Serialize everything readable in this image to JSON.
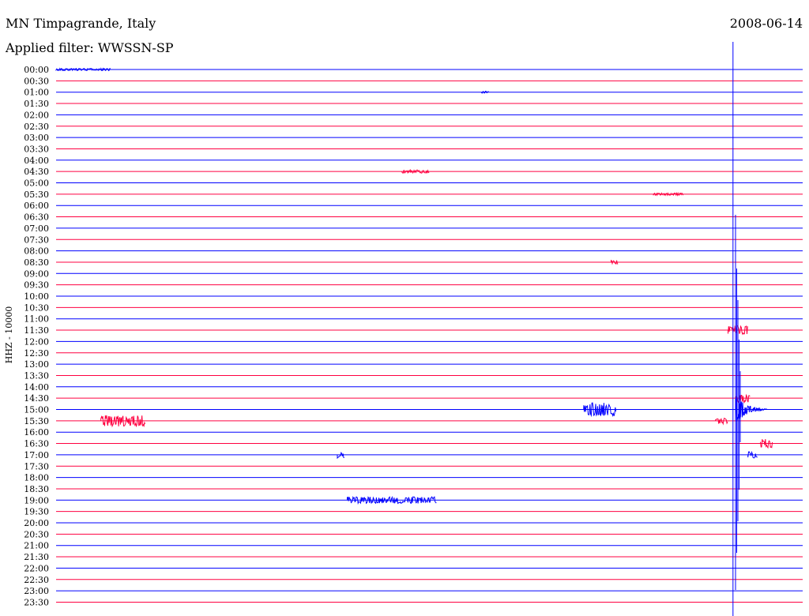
{
  "header": {
    "station": "MN Timpagrande, Italy",
    "date": "2008-06-14",
    "filter": "Applied filter: WWSSN-SP"
  },
  "chart_data": {
    "type": "line",
    "title": "MN Timpagrande, Italy",
    "subtitle": "Applied filter: WWSSN-SP",
    "date": "2008-06-14",
    "ylabel": "HHZ - 10000",
    "xlabel": "",
    "row_labels": [
      "00:00",
      "00:30",
      "01:00",
      "01:30",
      "02:00",
      "02:30",
      "03:00",
      "03:30",
      "04:00",
      "04:30",
      "05:00",
      "05:30",
      "06:00",
      "06:30",
      "07:00",
      "07:30",
      "08:00",
      "08:30",
      "09:00",
      "09:30",
      "10:00",
      "10:30",
      "11:00",
      "11:30",
      "12:00",
      "12:30",
      "13:00",
      "13:30",
      "14:00",
      "14:30",
      "15:00",
      "15:30",
      "16:00",
      "16:30",
      "17:00",
      "17:30",
      "18:00",
      "18:30",
      "19:00",
      "19:30",
      "20:00",
      "20:30",
      "21:00",
      "21:30",
      "22:00",
      "22:30",
      "23:00",
      "23:30"
    ],
    "trace_colors": [
      "#0000ff",
      "#ff0040"
    ],
    "row_minutes": 30,
    "marker_minute": 27.2,
    "events": [
      {
        "row": 0,
        "start": 0.0,
        "end": 2.2,
        "amp": 1
      },
      {
        "row": 2,
        "start": 17.1,
        "end": 17.4,
        "amp": 1
      },
      {
        "row": 9,
        "start": 13.9,
        "end": 15.0,
        "amp": 1.5
      },
      {
        "row": 11,
        "start": 24.0,
        "end": 25.2,
        "amp": 1
      },
      {
        "row": 17,
        "start": 22.3,
        "end": 22.6,
        "amp": 2
      },
      {
        "row": 23,
        "start": 27.0,
        "end": 27.8,
        "amp": 4
      },
      {
        "row": 29,
        "start": 27.3,
        "end": 27.9,
        "amp": 4
      },
      {
        "row": 30,
        "start": 21.2,
        "end": 22.5,
        "amp": 6
      },
      {
        "row": 31,
        "start": 1.8,
        "end": 3.6,
        "amp": 5
      },
      {
        "row": 31,
        "start": 26.5,
        "end": 27.0,
        "amp": 3
      },
      {
        "row": 33,
        "start": 28.3,
        "end": 28.8,
        "amp": 4
      },
      {
        "row": 34,
        "start": 11.3,
        "end": 11.6,
        "amp": 3
      },
      {
        "row": 34,
        "start": 27.8,
        "end": 28.2,
        "amp": 3
      },
      {
        "row": 38,
        "start": 11.7,
        "end": 15.3,
        "amp": 3
      }
    ],
    "quake": {
      "row": 30,
      "minute": 27.3,
      "peak_amp": 250
    }
  }
}
